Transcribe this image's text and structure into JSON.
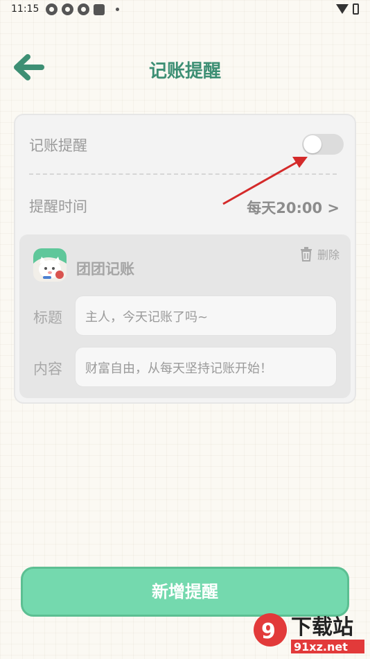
{
  "status_bar": {
    "time": "11:15"
  },
  "header": {
    "title": "记账提醒"
  },
  "reminder": {
    "toggle_label": "记账提醒",
    "toggle_on": false,
    "time_label": "提醒时间",
    "time_value": "每天20:00 >"
  },
  "item": {
    "app_name": "团团记账",
    "delete_label": "删除",
    "title_label": "标题",
    "title_value": "主人，今天记账了吗~",
    "content_label": "内容",
    "content_value": "财富自由，从每天坚持记账开始！"
  },
  "actions": {
    "add_label": "新增提醒"
  },
  "watermark": {
    "name": "下载站",
    "url": "91xz.net"
  },
  "colors": {
    "accent": "#3d8f74",
    "button": "#74d9ae",
    "arrow": "#d42a2a"
  }
}
